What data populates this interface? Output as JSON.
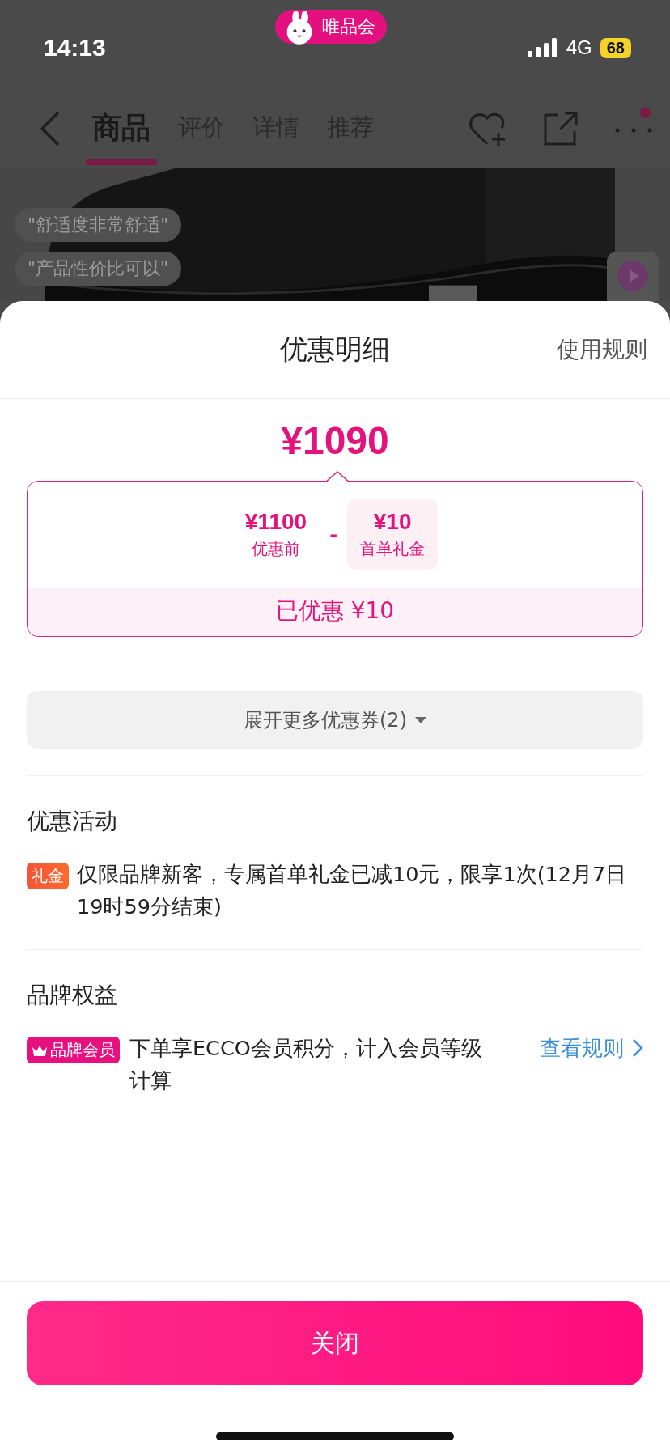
{
  "status_bar": {
    "time": "14:13",
    "network": "4G",
    "battery": "68"
  },
  "app_badge": {
    "label": "唯品会"
  },
  "nav": {
    "tabs": [
      {
        "label": "商品",
        "selected": true
      },
      {
        "label": "评价",
        "selected": false
      },
      {
        "label": "详情",
        "selected": false
      },
      {
        "label": "推荐",
        "selected": false
      }
    ],
    "more_has_dot": true
  },
  "product": {
    "review_chips": [
      "\"舒适度非常舒适\"",
      "\"产品性价比可以\""
    ]
  },
  "sheet": {
    "title": "优惠明细",
    "rules_link": "使用规则",
    "price": "¥1090",
    "breakdown": {
      "original_price": "¥1100",
      "original_label": "优惠前",
      "operator": "-",
      "discount_amount": "¥10",
      "discount_label": "首单礼金"
    },
    "saved_text": "已优惠 ¥10",
    "expand_button": "展开更多优惠券(2)",
    "sections": [
      {
        "heading": "优惠活动",
        "items": [
          {
            "kind": "gift",
            "tag": "礼金",
            "text": "仅限品牌新客，专属首单礼金已减10元，限享1次(12月7日19时59分结束)"
          }
        ]
      },
      {
        "heading": "品牌权益",
        "items": [
          {
            "kind": "member",
            "tag": "品牌会员",
            "text": "下单享ECCO会员积分，计入会员等级计算",
            "link": "查看规则"
          }
        ]
      }
    ],
    "close_button": "关闭"
  }
}
